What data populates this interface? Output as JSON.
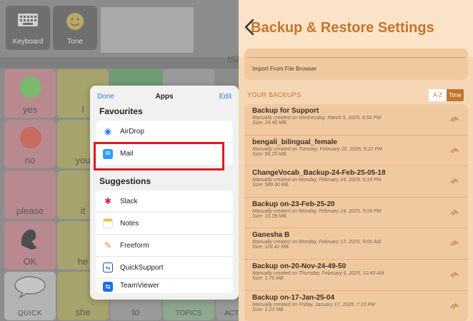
{
  "left_app": {
    "keyboard_label": "Keyboard",
    "tone_label": "Tone",
    "home_link": "HO",
    "cells": [
      {
        "label": "yes"
      },
      {
        "label": "I"
      },
      {
        "label": "no"
      },
      {
        "label": "you"
      },
      {
        "label": "please"
      },
      {
        "label": "it"
      },
      {
        "label": "OK"
      },
      {
        "label": "he"
      },
      {
        "label": "QUICK"
      },
      {
        "label": "she"
      },
      {
        "label": "to"
      },
      {
        "label": "TOPICS"
      },
      {
        "label": "ACT"
      }
    ]
  },
  "apps_popover": {
    "done": "Done",
    "title": "Apps",
    "edit": "Edit",
    "favourites_heading": "Favourites",
    "favourites": [
      {
        "name": "AirDrop",
        "icon": "airdrop-icon"
      },
      {
        "name": "Mail",
        "icon": "mail-icon"
      }
    ],
    "suggestions_heading": "Suggestions",
    "suggestions": [
      {
        "name": "Slack",
        "icon": "slack-icon"
      },
      {
        "name": "Notes",
        "icon": "notes-icon"
      },
      {
        "name": "Freeform",
        "icon": "freeform-icon"
      },
      {
        "name": "QuickSupport",
        "icon": "quicksupport-icon"
      },
      {
        "name": "TeamViewer",
        "icon": "teamviewer-icon"
      }
    ],
    "highlight_color": "#e0191f"
  },
  "settings": {
    "title": "Backup & Restore Settings",
    "import_label": "Import From File Browser",
    "your_backups_heading": "YOUR BACKUPS",
    "sort_az": "A-Z",
    "sort_time": "Time",
    "accent_color": "#c1762c",
    "backups": [
      {
        "name": "Backup for Support",
        "detail": "Manually created on Wednesday, March 5, 2025, 6:56 PM",
        "size": "Size: 24.46 MB."
      },
      {
        "name": "bengali_bilingual_female",
        "detail": "Manually created on Tuesday, February 25, 2025, 9:22 PM",
        "size": "Size: 56.25 MB."
      },
      {
        "name": "ChangeVocab_Backup-24-Feb-25-05-18",
        "detail": "Manually created on Monday, February 24, 2025, 5:18 PM",
        "size": "Size: 589.90 KB."
      },
      {
        "name": "Backup on-23-Feb-25-20",
        "detail": "Manually created on Monday, February 24, 2025, 5:09 PM",
        "size": "Size: 16.39 MB."
      },
      {
        "name": "Ganesha B",
        "detail": "Manually created on Monday, February 17, 2025, 9:06 AM",
        "size": "Size: 118.41 MB."
      },
      {
        "name": "Backup on-20-Nov-24-49-50",
        "detail": "Manually created on Thursday, February 6, 2025, 10:43 AM",
        "size": "Size: 1.79 MB."
      },
      {
        "name": "Backup on-17-Jan-25-04",
        "detail": "Manually created on Friday, January 17, 2025, 7:13 PM",
        "size": "Size: 1.23 MB."
      }
    ]
  }
}
